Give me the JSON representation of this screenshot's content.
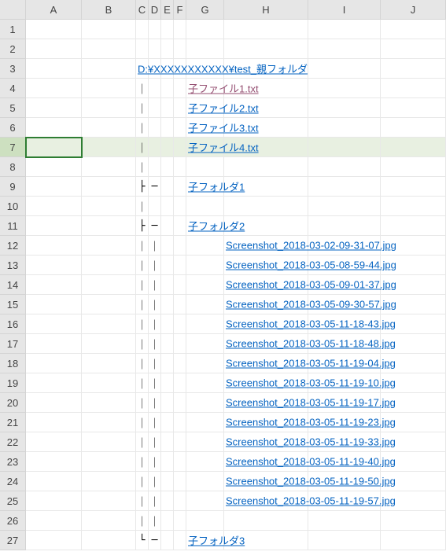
{
  "columns": [
    "",
    "A",
    "B",
    "C",
    "D",
    "E",
    "F",
    "G",
    "H",
    "I",
    "J"
  ],
  "rowCount": 27,
  "selectedRow": 7,
  "activeCell": {
    "row": 7,
    "col": 1
  },
  "cells": {
    "3": {
      "C": {
        "text": "D:¥XXXXXXXXXXX¥test_親フォルダ",
        "style": "link",
        "span": true
      }
    },
    "4": {
      "C": {
        "text": "｜",
        "style": "tree"
      },
      "G": {
        "text": "子ファイル1.txt",
        "style": "visited",
        "span": true
      }
    },
    "5": {
      "C": {
        "text": "｜",
        "style": "tree"
      },
      "G": {
        "text": "子ファイル2.txt",
        "style": "link",
        "span": true
      }
    },
    "6": {
      "C": {
        "text": "｜",
        "style": "tree"
      },
      "G": {
        "text": "子ファイル3.txt",
        "style": "link",
        "span": true
      }
    },
    "7": {
      "C": {
        "text": "｜",
        "style": "tree"
      },
      "G": {
        "text": "子ファイル4.txt",
        "style": "link",
        "span": true
      }
    },
    "8": {
      "C": {
        "text": "｜",
        "style": "tree"
      }
    },
    "9": {
      "C": {
        "text": "├",
        "style": "tree"
      },
      "D": {
        "text": "─",
        "style": "tree"
      },
      "G": {
        "text": "子フォルダ1",
        "style": "link",
        "span": true
      }
    },
    "10": {
      "C": {
        "text": "｜",
        "style": "tree"
      }
    },
    "11": {
      "C": {
        "text": "├",
        "style": "tree"
      },
      "D": {
        "text": "─",
        "style": "tree"
      },
      "G": {
        "text": "子フォルダ2",
        "style": "link",
        "span": true
      }
    },
    "12": {
      "C": {
        "text": "｜",
        "style": "tree"
      },
      "D": {
        "text": "｜",
        "style": "tree"
      },
      "H": {
        "text": "Screenshot_2018-03-02-09-31-07.jpg",
        "style": "link",
        "span": true
      }
    },
    "13": {
      "C": {
        "text": "｜",
        "style": "tree"
      },
      "D": {
        "text": "｜",
        "style": "tree"
      },
      "H": {
        "text": "Screenshot_2018-03-05-08-59-44.jpg",
        "style": "link",
        "span": true
      }
    },
    "14": {
      "C": {
        "text": "｜",
        "style": "tree"
      },
      "D": {
        "text": "｜",
        "style": "tree"
      },
      "H": {
        "text": "Screenshot_2018-03-05-09-01-37.jpg",
        "style": "link",
        "span": true
      }
    },
    "15": {
      "C": {
        "text": "｜",
        "style": "tree"
      },
      "D": {
        "text": "｜",
        "style": "tree"
      },
      "H": {
        "text": "Screenshot_2018-03-05-09-30-57.jpg",
        "style": "link",
        "span": true
      }
    },
    "16": {
      "C": {
        "text": "｜",
        "style": "tree"
      },
      "D": {
        "text": "｜",
        "style": "tree"
      },
      "H": {
        "text": "Screenshot_2018-03-05-11-18-43.jpg",
        "style": "link",
        "span": true
      }
    },
    "17": {
      "C": {
        "text": "｜",
        "style": "tree"
      },
      "D": {
        "text": "｜",
        "style": "tree"
      },
      "H": {
        "text": "Screenshot_2018-03-05-11-18-48.jpg",
        "style": "link",
        "span": true
      }
    },
    "18": {
      "C": {
        "text": "｜",
        "style": "tree"
      },
      "D": {
        "text": "｜",
        "style": "tree"
      },
      "H": {
        "text": "Screenshot_2018-03-05-11-19-04.jpg",
        "style": "link",
        "span": true
      }
    },
    "19": {
      "C": {
        "text": "｜",
        "style": "tree"
      },
      "D": {
        "text": "｜",
        "style": "tree"
      },
      "H": {
        "text": "Screenshot_2018-03-05-11-19-10.jpg",
        "style": "link",
        "span": true
      }
    },
    "20": {
      "C": {
        "text": "｜",
        "style": "tree"
      },
      "D": {
        "text": "｜",
        "style": "tree"
      },
      "H": {
        "text": "Screenshot_2018-03-05-11-19-17.jpg",
        "style": "link",
        "span": true
      }
    },
    "21": {
      "C": {
        "text": "｜",
        "style": "tree"
      },
      "D": {
        "text": "｜",
        "style": "tree"
      },
      "H": {
        "text": "Screenshot_2018-03-05-11-19-23.jpg",
        "style": "link",
        "span": true
      }
    },
    "22": {
      "C": {
        "text": "｜",
        "style": "tree"
      },
      "D": {
        "text": "｜",
        "style": "tree"
      },
      "H": {
        "text": "Screenshot_2018-03-05-11-19-33.jpg",
        "style": "link",
        "span": true
      }
    },
    "23": {
      "C": {
        "text": "｜",
        "style": "tree"
      },
      "D": {
        "text": "｜",
        "style": "tree"
      },
      "H": {
        "text": "Screenshot_2018-03-05-11-19-40.jpg",
        "style": "link",
        "span": true
      }
    },
    "24": {
      "C": {
        "text": "｜",
        "style": "tree"
      },
      "D": {
        "text": "｜",
        "style": "tree"
      },
      "H": {
        "text": "Screenshot_2018-03-05-11-19-50.jpg",
        "style": "link",
        "span": true
      }
    },
    "25": {
      "C": {
        "text": "｜",
        "style": "tree"
      },
      "D": {
        "text": "｜",
        "style": "tree"
      },
      "H": {
        "text": "Screenshot_2018-03-05-11-19-57.jpg",
        "style": "link",
        "span": true
      }
    },
    "26": {
      "C": {
        "text": "｜",
        "style": "tree"
      },
      "D": {
        "text": "｜",
        "style": "tree"
      }
    },
    "27": {
      "C": {
        "text": "└",
        "style": "tree"
      },
      "D": {
        "text": "─",
        "style": "tree"
      },
      "G": {
        "text": "子フォルダ3",
        "style": "link",
        "span": true
      }
    }
  }
}
